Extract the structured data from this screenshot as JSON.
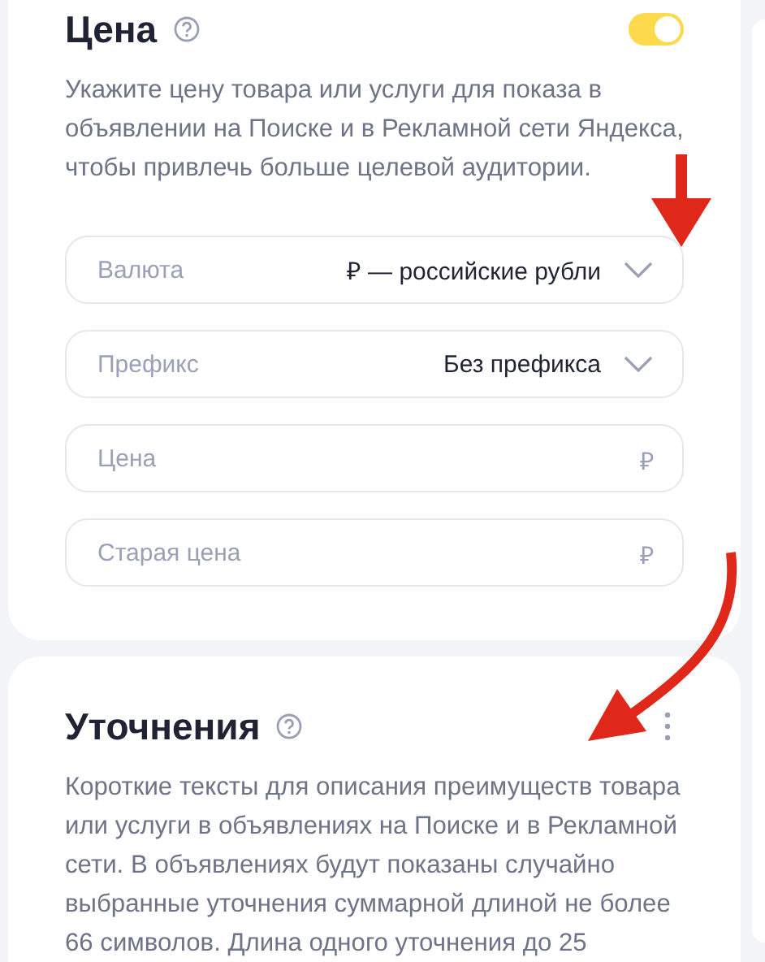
{
  "price": {
    "title": "Цена",
    "toggle": {
      "on": true
    },
    "description": "Укажите цену товара или услуги для показа в объявлении на Поиске и в Рекламной сети Яндекса, чтобы привлечь больше целевой аудитории.",
    "fields": [
      {
        "kind": "select",
        "label": "Валюта",
        "value": "₽ — российские рубли"
      },
      {
        "kind": "select",
        "label": "Префикс",
        "value": "Без префикса"
      },
      {
        "kind": "input",
        "placeholder": "Цена",
        "suffix": "₽"
      },
      {
        "kind": "input",
        "placeholder": "Старая цена",
        "suffix": "₽"
      }
    ]
  },
  "clarifications": {
    "title": "Уточнения",
    "description": "Короткие тексты для описания преимуществ товара или услуги в объявлениях на Поиске и в Рекламной сети. В объявлениях будут показаны случайно выбранные уточнения суммарной длиной не более 66 символов. Длина одного уточнения до 25"
  }
}
